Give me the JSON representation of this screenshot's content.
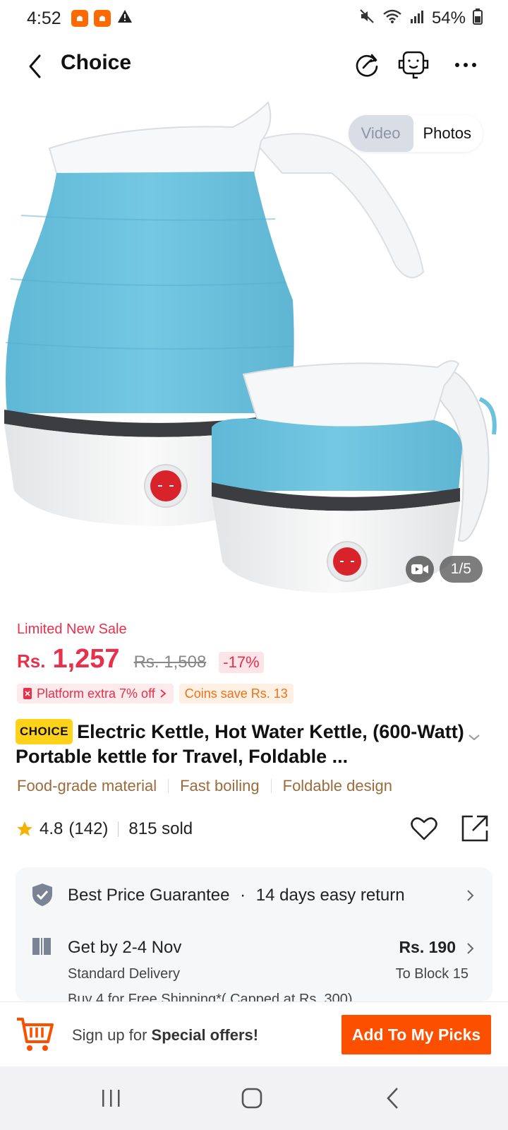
{
  "status_bar": {
    "time": "4:52",
    "battery": "54%"
  },
  "nav": {
    "title": "Choice"
  },
  "gallery": {
    "video_label": "Video",
    "photos_label": "Photos",
    "counter": "1/5"
  },
  "pricing": {
    "promo_label": "Limited New Sale",
    "currency": "Rs.",
    "price": "1,257",
    "old_price": "Rs. 1,508",
    "discount": "-17%",
    "platform_tag": "Platform extra 7% off",
    "coins_tag": "Coins save Rs. 13"
  },
  "product": {
    "badge": "CHOICE",
    "title": "Electric Kettle, Hot Water Kettle, (600-Watt) Portable kettle for Travel, Foldable ...",
    "features": [
      "Food-grade material",
      "Fast boiling",
      "Foldable design"
    ],
    "rating": "4.8",
    "reviews": "(142)",
    "sold": "815 sold"
  },
  "info": {
    "guarantee": "Best Price Guarantee",
    "returns": "14 days easy return",
    "delivery_title": "Get by 2-4 Nov",
    "delivery_fee": "Rs. 190",
    "delivery_type": "Standard Delivery",
    "delivery_dest": "To Block 15",
    "shipping_note": "Buy 4 for Free Shipping*( Capped at Rs. 300)"
  },
  "bottom": {
    "signup_prefix": "Sign up for ",
    "signup_strong": "Special offers!",
    "add_button": "Add To My Picks"
  },
  "colors": {
    "accent_red": "#e8304b",
    "cta_orange": "#fd4f00",
    "feature_brown": "#9c6b3c",
    "choice_yellow": "#ffd21a",
    "kettle_blue": "#6cc2dd"
  }
}
